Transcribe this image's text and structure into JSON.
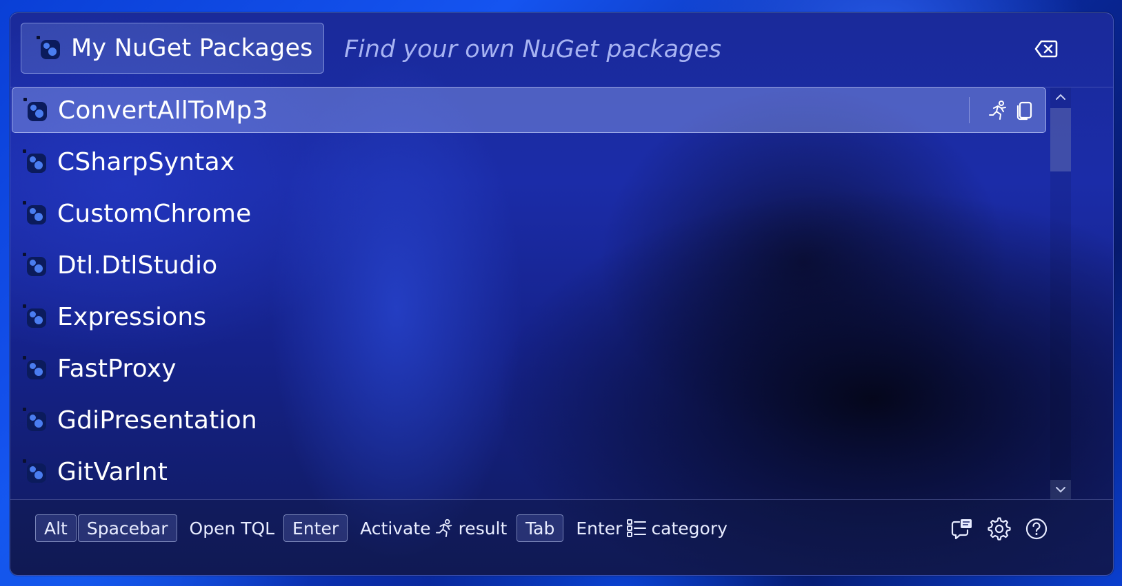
{
  "search": {
    "catalog_label": "My NuGet Packages",
    "placeholder": "Find your own NuGet packages",
    "value": ""
  },
  "results": [
    {
      "label": "ConvertAllToMp3",
      "selected": true
    },
    {
      "label": "CSharpSyntax"
    },
    {
      "label": "CustomChrome"
    },
    {
      "label": "Dtl.DtlStudio"
    },
    {
      "label": "Expressions"
    },
    {
      "label": "FastProxy"
    },
    {
      "label": "GdiPresentation"
    },
    {
      "label": "GitVarInt"
    }
  ],
  "row_actions": [
    "run-icon",
    "copy-icon"
  ],
  "footer": {
    "hint1": {
      "keys": [
        "Alt",
        "Spacebar"
      ],
      "text": "Open TQL"
    },
    "hint2": {
      "keys": [
        "Enter"
      ],
      "text_before": "Activate",
      "icon": "run-icon",
      "text_after": "result"
    },
    "hint3": {
      "keys": [
        "Tab"
      ],
      "text_before": "Enter",
      "icon": "list-icon",
      "text_after": "category"
    },
    "buttons": [
      "feedback-icon",
      "settings-icon",
      "help-icon"
    ]
  },
  "colors": {
    "accent": "#4a7df0",
    "placeholder": "#a7b3f2",
    "text": "#ffffff"
  }
}
